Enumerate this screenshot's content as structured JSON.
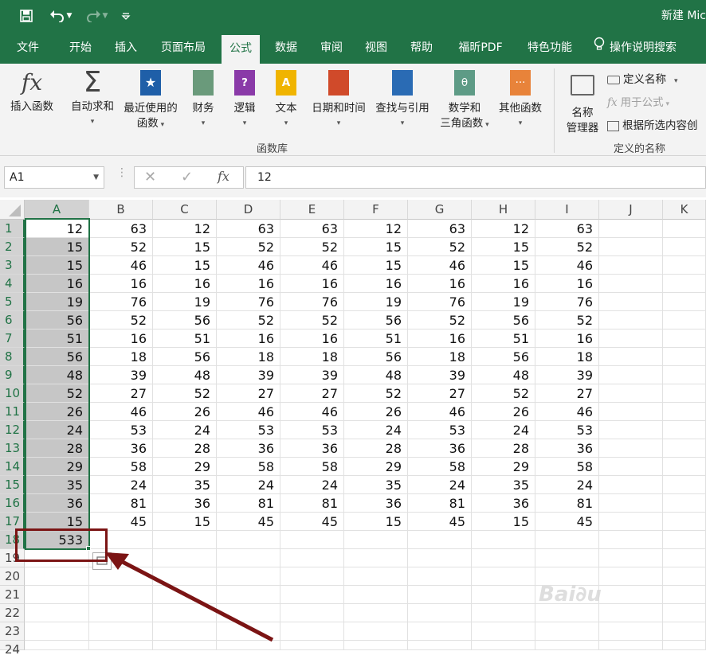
{
  "doc_title": "新建 Mic",
  "quick_access": {
    "save_icon": "save-icon",
    "undo_icon": "undo-icon",
    "redo_icon": "redo-icon",
    "customize_icon": "customize-icon"
  },
  "tabs": [
    "文件",
    "开始",
    "插入",
    "页面布局",
    "公式",
    "数据",
    "审阅",
    "视图",
    "帮助",
    "福昕PDF",
    "特色功能"
  ],
  "active_tab": "公式",
  "search_label": "操作说明搜索",
  "ribbon": {
    "insert_function": "插入函数",
    "autosum": "自动求和",
    "recent": [
      "最近使用的",
      "函数"
    ],
    "financial": "财务",
    "logical": "逻辑",
    "text": "文本",
    "datetime": "日期和时间",
    "lookup": "查找与引用",
    "math": [
      "数学和",
      "三角函数"
    ],
    "more": "其他函数",
    "group_library": "函数库",
    "name_manager": [
      "名称",
      "管理器"
    ],
    "define_name": "定义名称",
    "use_in_formula": "用于公式",
    "create_from_selection": "根据所选内容创",
    "group_names": "定义的名称"
  },
  "formula_bar": {
    "name_box": "A1",
    "formula": "12",
    "fx": "fx"
  },
  "columns": [
    "A",
    "B",
    "C",
    "D",
    "E",
    "F",
    "G",
    "H",
    "I",
    "J",
    "K"
  ],
  "rows": [
    [
      12,
      63,
      12,
      63,
      63,
      12,
      63,
      12,
      63
    ],
    [
      15,
      52,
      15,
      52,
      52,
      15,
      52,
      15,
      52
    ],
    [
      15,
      46,
      15,
      46,
      46,
      15,
      46,
      15,
      46
    ],
    [
      16,
      16,
      16,
      16,
      16,
      16,
      16,
      16,
      16
    ],
    [
      19,
      76,
      19,
      76,
      76,
      19,
      76,
      19,
      76
    ],
    [
      56,
      52,
      56,
      52,
      52,
      56,
      52,
      56,
      52
    ],
    [
      51,
      16,
      51,
      16,
      16,
      51,
      16,
      51,
      16
    ],
    [
      56,
      18,
      56,
      18,
      18,
      56,
      18,
      56,
      18
    ],
    [
      48,
      39,
      48,
      39,
      39,
      48,
      39,
      48,
      39
    ],
    [
      52,
      27,
      52,
      27,
      27,
      52,
      27,
      52,
      27
    ],
    [
      26,
      46,
      26,
      46,
      46,
      26,
      46,
      26,
      46
    ],
    [
      24,
      53,
      24,
      53,
      53,
      24,
      53,
      24,
      53
    ],
    [
      28,
      36,
      28,
      36,
      36,
      28,
      36,
      28,
      36
    ],
    [
      29,
      58,
      29,
      58,
      58,
      29,
      58,
      29,
      58
    ],
    [
      35,
      24,
      35,
      24,
      24,
      35,
      24,
      35,
      24
    ],
    [
      36,
      81,
      36,
      81,
      81,
      36,
      81,
      36,
      81
    ],
    [
      15,
      45,
      15,
      45,
      45,
      15,
      45,
      15,
      45
    ]
  ],
  "sum_cell": {
    "value": 533
  },
  "row_numbers": [
    "1",
    "2",
    "3",
    "4",
    "5",
    "6",
    "7",
    "8",
    "9",
    "10",
    "11",
    "12",
    "13",
    "14",
    "15",
    "16",
    "17",
    "18",
    "19",
    "20",
    "21",
    "22",
    "23",
    "24"
  ],
  "annotation": {
    "highlight_color": "#7b1414"
  },
  "colors": {
    "accent": "#217346",
    "selection": "#c6c6c6"
  }
}
